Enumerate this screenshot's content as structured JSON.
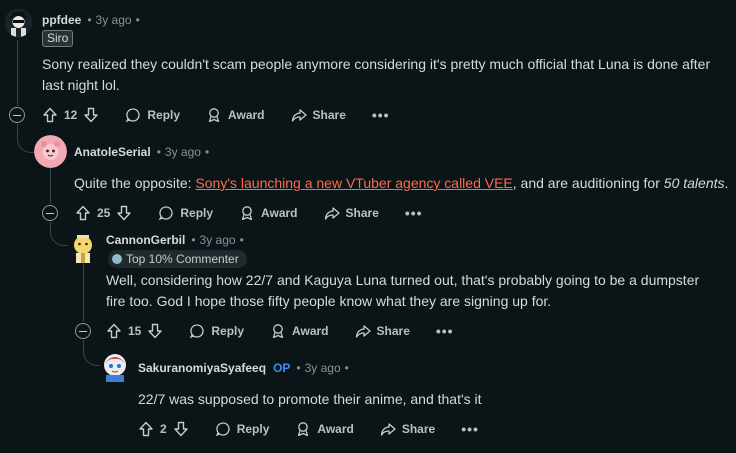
{
  "comments": [
    {
      "username": "ppfdee",
      "time": "3y ago",
      "flair": "Siro",
      "body": "Sony realized they couldn't scam people anymore considering it's pretty much official that Luna is done after last night lol.",
      "votes": "12",
      "actions": {
        "reply": "Reply",
        "award": "Award",
        "share": "Share"
      }
    },
    {
      "username": "AnatoleSerial",
      "time": "3y ago",
      "body_prefix": "Quite the opposite: ",
      "body_link": "Sony's launching a new VTuber agency called VEE",
      "body_middle": ", and are auditioning for ",
      "body_em": "50 talents",
      "body_suffix": ".",
      "votes": "25",
      "actions": {
        "reply": "Reply",
        "award": "Award",
        "share": "Share"
      }
    },
    {
      "username": "CannonGerbil",
      "time": "3y ago",
      "flair": "Top 10% Commenter",
      "body": "Well, considering how 22/7 and Kaguya Luna turned out, that's probably going to be a dumpster fire too. God I hope those fifty people know what they are signing up for.",
      "votes": "15",
      "actions": {
        "reply": "Reply",
        "award": "Award",
        "share": "Share"
      }
    },
    {
      "username": "SakuranomiyaSyafeeq",
      "op_badge": "OP",
      "time": "3y ago",
      "body": "22/7 was supposed to promote their anime, and that's it",
      "votes": "2",
      "actions": {
        "reply": "Reply",
        "award": "Award",
        "share": "Share"
      }
    }
  ],
  "separators": {
    "dot": "•"
  },
  "more": "•••",
  "colors": {
    "background": "#0b1416",
    "link": "#ff6a4d",
    "op": "#3a8ff5"
  }
}
